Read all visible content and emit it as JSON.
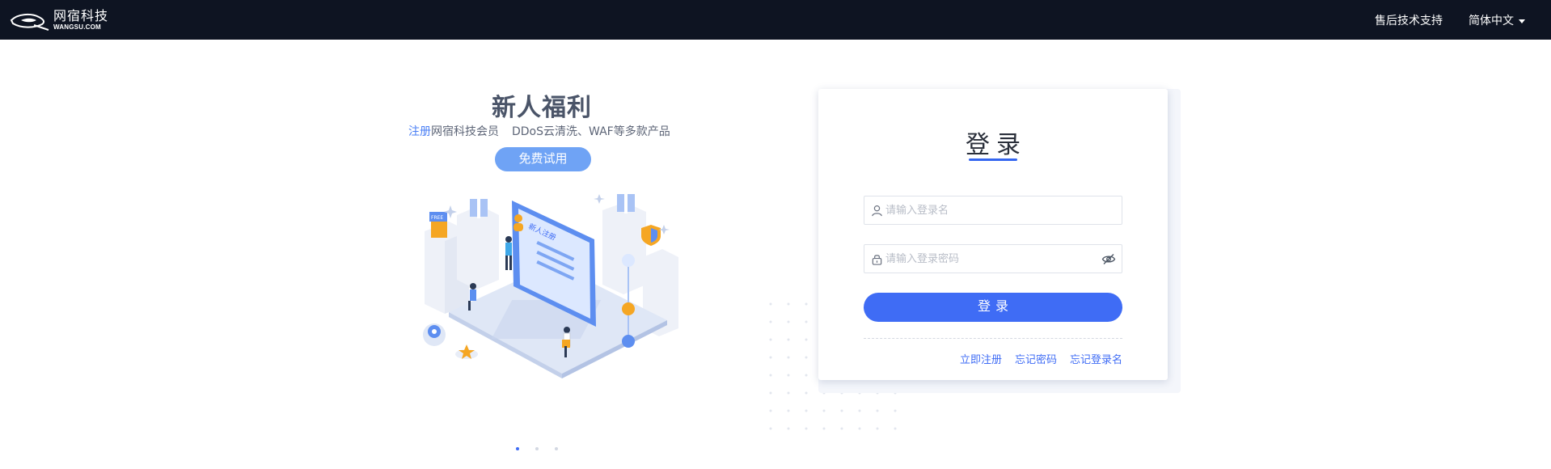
{
  "header": {
    "logo_cn": "网宿科技",
    "logo_en": "WANGSU.COM",
    "support_label": "售后技术支持",
    "language_label": "简体中文"
  },
  "promo": {
    "title": "新人福利",
    "sub_highlight": "注册",
    "sub_text_1": "网宿科技会员",
    "sub_text_2": "DDoS云清洗、WAF等多款产品",
    "trial_button": "免费试用",
    "illustration_labels": {
      "screen_label": "新人注册",
      "bag_label": "FREE"
    },
    "carousel_count": 3,
    "carousel_active": 0
  },
  "login": {
    "title": "登录",
    "username_placeholder": "请输入登录名",
    "password_placeholder": "请输入登录密码",
    "submit_label": "登录",
    "links": {
      "register": "立即注册",
      "forgot_password": "忘记密码",
      "forgot_username": "忘记登录名"
    }
  },
  "icons": {
    "username": "user-icon",
    "password": "lock-icon",
    "visibility": "eye-off-icon"
  },
  "colors": {
    "topbar": "#0e1422",
    "accent": "#3f6cf5",
    "trial_button": "#6fa3f5",
    "title_text": "#4a5468"
  }
}
